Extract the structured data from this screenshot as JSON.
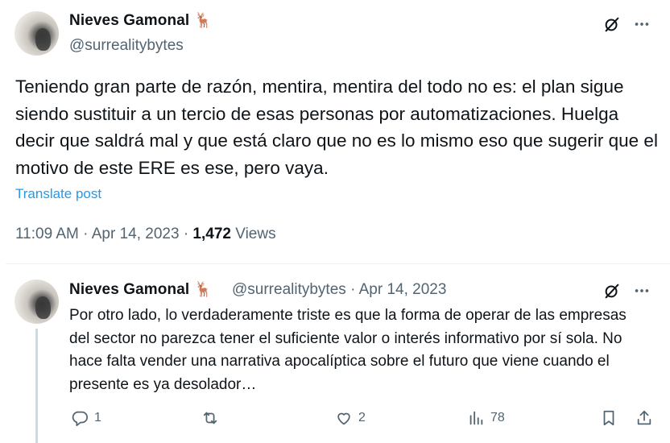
{
  "main_post": {
    "author_name": "Nieves Gamonal",
    "author_emoji": "🦌",
    "author_handle": "@surrealitybytes",
    "text": "Teniendo gran parte de razón, mentira, mentira del todo no es: el plan sigue siendo sustituir a un tercio de esas personas por automatizaciones. Huelga decir que saldrá mal y que está claro que no es lo mismo eso que sugerir que el motivo de este ERE es ese, pero vaya.",
    "translate_label": "Translate post",
    "time": "11:09 AM",
    "separator": "·",
    "date": "Apr 14, 2023",
    "views_count": "1,472",
    "views_label": "Views"
  },
  "reply_post": {
    "author_name": "Nieves Gamonal",
    "author_emoji": "🦌",
    "author_handle": "@surrealitybytes",
    "separator": "·",
    "date": "Apr 14, 2023",
    "text": "Por otro lado, lo verdaderamente triste es que la forma de operar de las empresas del sector no parezca tener el suficiente valor o interés informativo por sí sola. No hace falta vender una narrativa apocalíptica sobre el futuro que viene cuando el presente es ya desolador…",
    "replies": "1",
    "retweets": "",
    "likes": "2",
    "views": "78"
  },
  "icons": {
    "grok": "grok-icon",
    "more": "more-options-icon",
    "reply": "reply-icon",
    "retweet": "retweet-icon",
    "like": "like-icon",
    "views": "views-icon",
    "bookmark": "bookmark-icon",
    "share": "share-icon"
  },
  "colors": {
    "text": "#0f1419",
    "secondary": "#536471",
    "link": "#1d9bf0",
    "divider": "#eff3f4"
  }
}
